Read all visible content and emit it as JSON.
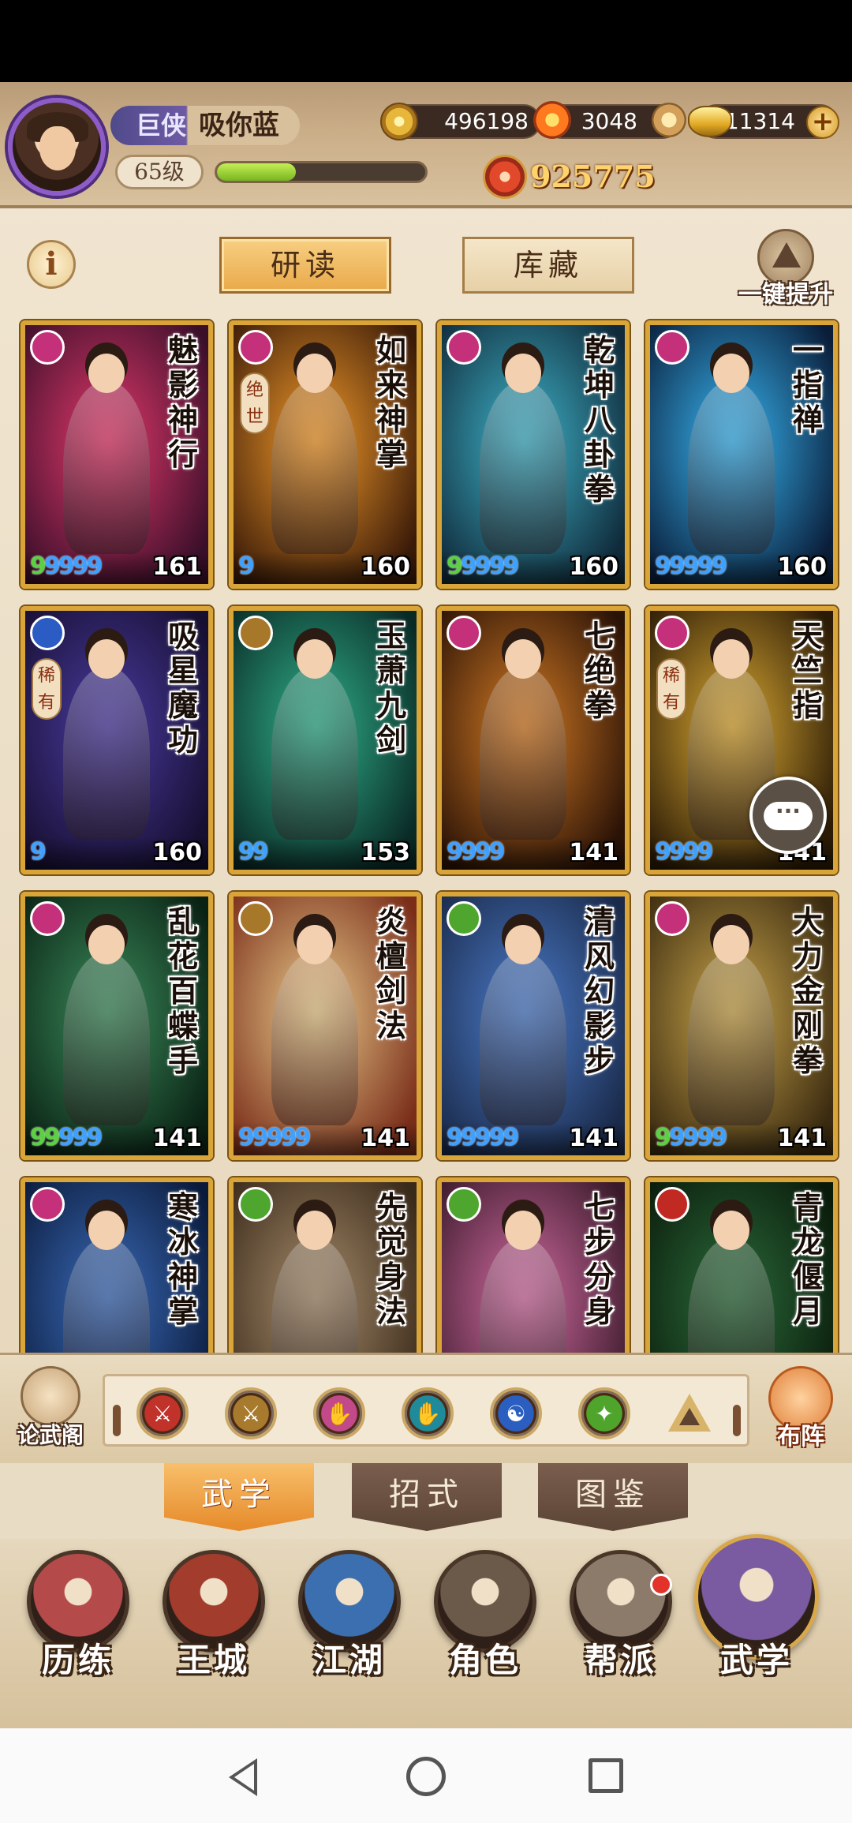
{
  "header": {
    "rank_badge": "巨侠",
    "player_name": "吸你蓝",
    "level": "65级",
    "exp_progress": 0.38,
    "coins": "496198",
    "flame": "3048",
    "gold_ingots": "11314",
    "power": "925775"
  },
  "subtabs": {
    "study": "研读",
    "storage": "库藏",
    "one_click_upgrade": "一键提升",
    "info": "i"
  },
  "cards": [
    {
      "name": "魅影神行",
      "school": "pink",
      "tag": "",
      "drops": {
        "green": 1,
        "blue": 4
      },
      "level": "161"
    },
    {
      "name": "如来神掌",
      "school": "pink",
      "tag": "绝世",
      "drops": {
        "green": 0,
        "blue": 1
      },
      "level": "160"
    },
    {
      "name": "乾坤八卦拳",
      "school": "pink",
      "tag": "",
      "drops": {
        "green": 1,
        "blue": 4
      },
      "level": "160"
    },
    {
      "name": "一指禅",
      "school": "pink",
      "tag": "",
      "drops": {
        "green": 0,
        "blue": 5
      },
      "level": "160"
    },
    {
      "name": "吸星魔功",
      "school": "blue",
      "tag": "稀有",
      "drops": {
        "green": 0,
        "blue": 1
      },
      "level": "160"
    },
    {
      "name": "玉萧九剑",
      "school": "gold",
      "tag": "",
      "drops": {
        "green": 0,
        "blue": 2
      },
      "level": "153"
    },
    {
      "name": "七绝拳",
      "school": "pink",
      "tag": "",
      "drops": {
        "green": 0,
        "blue": 4
      },
      "level": "141"
    },
    {
      "name": "天竺指",
      "school": "pink",
      "tag": "稀有",
      "drops": {
        "green": 0,
        "blue": 4
      },
      "level": "141"
    },
    {
      "name": "乱花百蝶手",
      "school": "pink",
      "tag": "",
      "drops": {
        "green": 2,
        "blue": 3
      },
      "level": "141"
    },
    {
      "name": "炎檀剑法",
      "school": "gold",
      "tag": "",
      "drops": {
        "green": 0,
        "blue": 5
      },
      "level": "141"
    },
    {
      "name": "清风幻影步",
      "school": "green",
      "tag": "",
      "drops": {
        "green": 0,
        "blue": 5
      },
      "level": "141"
    },
    {
      "name": "大力金刚拳",
      "school": "pink",
      "tag": "",
      "drops": {
        "green": 1,
        "blue": 4
      },
      "level": "141"
    },
    {
      "name": "寒冰神掌",
      "school": "pink",
      "tag": "",
      "drops": {
        "green": 0,
        "blue": 0
      },
      "level": ""
    },
    {
      "name": "先觉身法",
      "school": "green",
      "tag": "",
      "drops": {
        "green": 0,
        "blue": 0
      },
      "level": ""
    },
    {
      "name": "七步分身",
      "school": "green",
      "tag": "",
      "drops": {
        "green": 0,
        "blue": 0
      },
      "level": ""
    },
    {
      "name": "青龙偃月",
      "school": "red",
      "tag": "",
      "drops": {
        "green": 0,
        "blue": 0
      },
      "level": ""
    }
  ],
  "filter_bar": {
    "left_label": "论武阁",
    "right_label": "布阵",
    "filters": [
      {
        "name": "sword-red-filter-icon",
        "color": "#c0322a"
      },
      {
        "name": "sword-gold-filter-icon",
        "color": "#a87a2e"
      },
      {
        "name": "fist-pink-filter-icon",
        "color": "#c24a8a"
      },
      {
        "name": "palm-teal-filter-icon",
        "color": "#1f8a9a"
      },
      {
        "name": "taiji-blue-filter-icon",
        "color": "#2a5ec0"
      },
      {
        "name": "step-green-filter-icon",
        "color": "#4fa52c"
      }
    ]
  },
  "section_tabs": {
    "wuxue": "武学",
    "zhaoshi": "招式",
    "tujian": "图鉴"
  },
  "bottom_nav": [
    {
      "label": "历练",
      "color": "#b54a4a"
    },
    {
      "label": "王城",
      "color": "#a23c2c"
    },
    {
      "label": "江湖",
      "color": "#3b6fb0"
    },
    {
      "label": "角色",
      "color": "#6b5a4a"
    },
    {
      "label": "帮派",
      "color": "#8c7a6a"
    },
    {
      "label": "武学",
      "color": "#7a5aa0"
    }
  ],
  "school_colors": {
    "pink": "#c4307a",
    "blue": "#2a5cc4",
    "gold": "#a8782a",
    "green": "#4ea62e",
    "red": "#c02a22"
  },
  "card_art_colors": [
    [
      "#e2386a",
      "#3a0f2a"
    ],
    [
      "#f29a2a",
      "#3a1a08"
    ],
    [
      "#3fb3c9",
      "#0f2a3a"
    ],
    [
      "#37b5f2",
      "#0a1e3a"
    ],
    [
      "#4a3aa0",
      "#160f30"
    ],
    [
      "#2fb08a",
      "#0a2a26"
    ],
    [
      "#d27a24",
      "#2a1206"
    ],
    [
      "#d9a832",
      "#2a1a06"
    ],
    [
      "#3a8a5a",
      "#0a2214"
    ],
    [
      "#e8c98a",
      "#7a2e1a"
    ],
    [
      "#4a7ac8",
      "#1a2a4a"
    ],
    [
      "#c8a44a",
      "#3a2a10"
    ],
    [
      "#3a6ab8",
      "#0a1a3a"
    ],
    [
      "#a48a6a",
      "#3a2a1a"
    ],
    [
      "#d06aa0",
      "#3a1a2a"
    ],
    [
      "#2a6a3a",
      "#0a1a0a"
    ]
  ]
}
